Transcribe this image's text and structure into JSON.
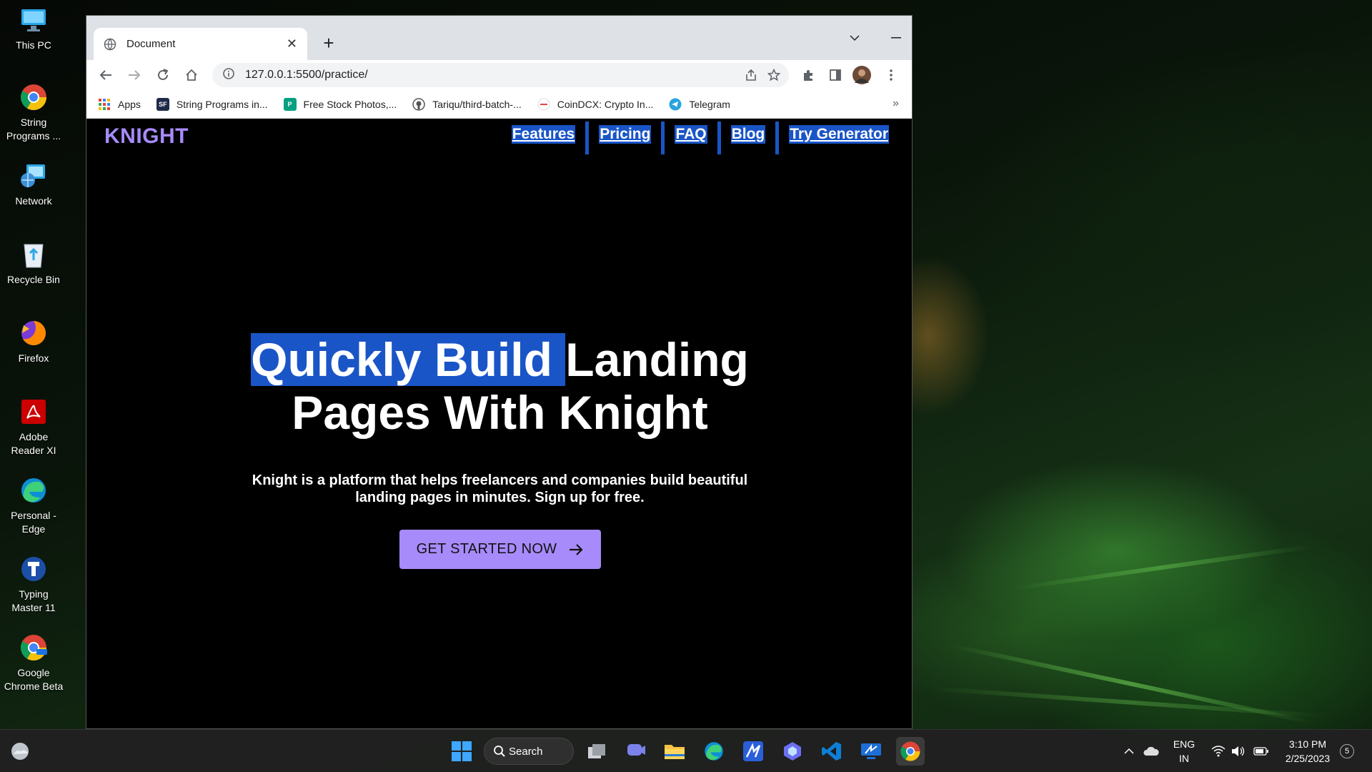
{
  "desktop": {
    "icons": [
      {
        "name": "This PC"
      },
      {
        "name": "String\nPrograms ..."
      },
      {
        "name": "Network"
      },
      {
        "name": "Recycle Bin"
      },
      {
        "name": "Firefox"
      },
      {
        "name": "Adobe\nReader XI"
      },
      {
        "name": "Personal -\nEdge"
      },
      {
        "name": "Typing\nMaster 11"
      },
      {
        "name": "Google\nChrome Beta"
      }
    ]
  },
  "browser": {
    "tab_title": "Document",
    "url": "127.0.0.1:5500/practice/",
    "bookmarks": [
      {
        "label": "Apps",
        "icon": "apps-grid-icon"
      },
      {
        "label": "String Programs in...",
        "icon": "sf-icon"
      },
      {
        "label": "Free Stock Photos,...",
        "icon": "pexels-icon"
      },
      {
        "label": "Tariqu/third-batch-...",
        "icon": "github-icon"
      },
      {
        "label": "CoinDCX: Crypto In...",
        "icon": "coindcx-icon"
      },
      {
        "label": "Telegram",
        "icon": "telegram-icon"
      }
    ],
    "more_bookmarks": "»"
  },
  "page": {
    "logo": "KNIGHT",
    "nav": [
      "Features",
      "Pricing",
      "FAQ",
      "Blog",
      "Try Generator"
    ],
    "hero_highlight": "Quickly Build ",
    "hero_rest_line1": "Landing",
    "hero_line2": "Pages With Knight",
    "subtitle": "Knight is a platform that helps freelancers and companies build beautiful landing pages in minutes. Sign up for free.",
    "cta_label": "GET STARTED NOW",
    "colors": {
      "accent": "#a78bfa",
      "selection": "#1a55c7"
    }
  },
  "taskbar": {
    "search_label": "Search",
    "lang_line1": "ENG",
    "lang_line2": "IN",
    "time": "3:10 PM",
    "date": "2/25/2023",
    "notifications": "5"
  }
}
